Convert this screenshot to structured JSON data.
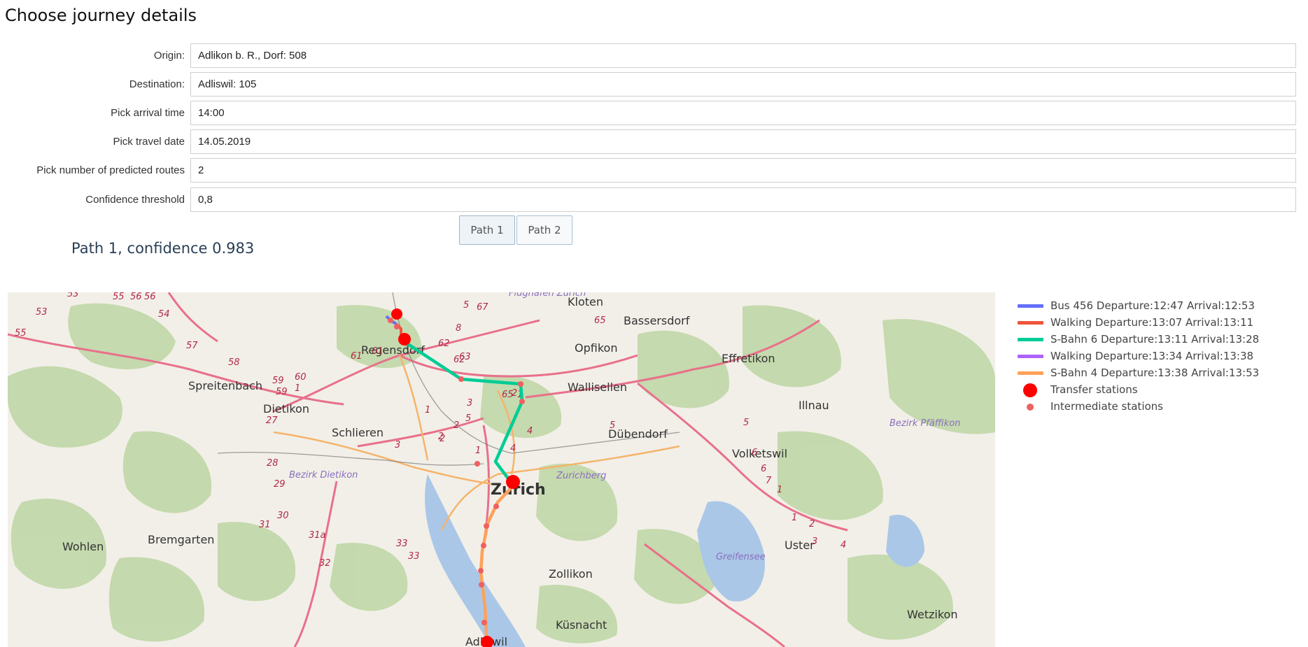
{
  "page": {
    "title": "Choose journey details"
  },
  "form": {
    "fields": [
      {
        "label": "Origin:",
        "value": "Adlikon b. R., Dorf: 508"
      },
      {
        "label": "Destination:",
        "value": "Adliswil: 105"
      },
      {
        "label": "Pick arrival time",
        "value": "14:00"
      },
      {
        "label": "Pick travel date",
        "value": "14.05.2019"
      },
      {
        "label": "Pick number of predicted routes",
        "value": "2"
      },
      {
        "label": "Confidence threshold",
        "value": "0,8"
      }
    ]
  },
  "tabs": [
    {
      "label": "Path 1",
      "active": true
    },
    {
      "label": "Path 2",
      "active": false
    }
  ],
  "result": {
    "heading": "Path 1, confidence 0.983"
  },
  "legend": {
    "items": [
      {
        "label": "Bus 456  Departure:12:47  Arrival:12:53",
        "color": "#636efa",
        "kind": "line"
      },
      {
        "label": "Walking  Departure:13:07  Arrival:13:11",
        "color": "#ef553b",
        "kind": "line"
      },
      {
        "label": "S-Bahn 6  Departure:13:11  Arrival:13:28",
        "color": "#00cc96",
        "kind": "line"
      },
      {
        "label": "Walking  Departure:13:34  Arrival:13:38",
        "color": "#ab63fa",
        "kind": "line"
      },
      {
        "label": "S-Bahn 4  Departure:13:38  Arrival:13:53",
        "color": "#ffa15a",
        "kind": "line"
      },
      {
        "label": "Transfer stations",
        "color": "#ff0000",
        "kind": "big-dot"
      },
      {
        "label": "Intermediate stations",
        "color": "#ef6060",
        "kind": "small-dot"
      }
    ]
  },
  "map": {
    "place_labels": [
      "Kloten",
      "Bassersdorf",
      "Opfikon",
      "Regensdorf",
      "Effretikon",
      "Wallisellen",
      "Spreitenbach",
      "Dietikon",
      "Illnau",
      "Schlieren",
      "Dübendorf",
      "Volketswil",
      "Zurich",
      "Wohlen",
      "Bremgarten",
      "Uster",
      "Zollikon",
      "Wetzikon",
      "Küsnacht",
      "Adliswil"
    ],
    "district_labels": [
      "Flughafen Zürich",
      "Bezirk Pfäffikon",
      "Bezirk Dietikon",
      "Zurichberg",
      "Greifensee"
    ],
    "road_numbers": [
      "53",
      "55",
      "55",
      "56",
      "56",
      "54",
      "53",
      "57",
      "58",
      "59",
      "59",
      "60",
      "1",
      "27",
      "28",
      "29",
      "30",
      "31",
      "31a",
      "32",
      "33",
      "33",
      "62",
      "62",
      "61",
      "61",
      "63",
      "8",
      "5",
      "67",
      "65",
      "65",
      "1",
      "1",
      "2",
      "3",
      "5",
      "2",
      "2",
      "2",
      "3",
      "1",
      "4",
      "4",
      "5",
      "5",
      "6",
      "6",
      "7",
      "1",
      "1",
      "2",
      "3",
      "4"
    ],
    "colors": {
      "transfer": "#ff0000",
      "intermediate": "#ef6060",
      "lake": "#aac7e8",
      "forest": "#b9d39e",
      "motorway": "#e8708a",
      "road": "#f5b46c"
    }
  }
}
